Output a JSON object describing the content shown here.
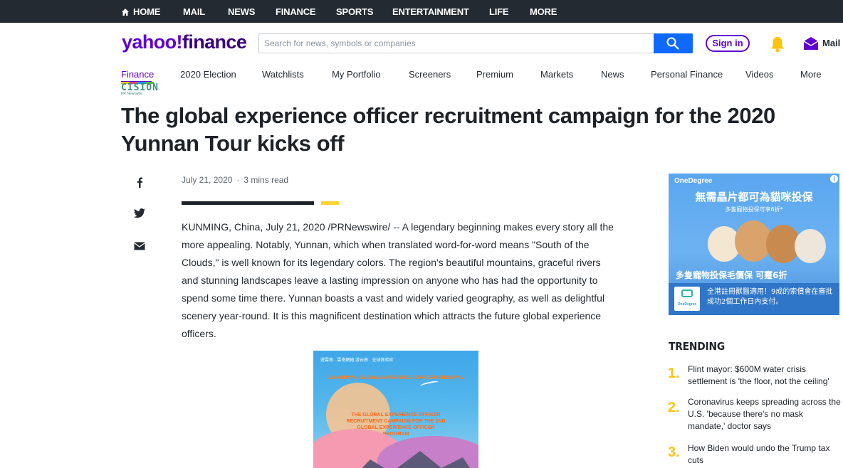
{
  "topnav": {
    "items": [
      "HOME",
      "MAIL",
      "NEWS",
      "FINANCE",
      "SPORTS",
      "ENTERTAINMENT",
      "LIFE",
      "MORE"
    ]
  },
  "header": {
    "logo_brand": "yahoo!",
    "logo_section": "finance",
    "search_placeholder": "Search for news, symbols or companies",
    "search_value": "",
    "signin_label": "Sign in",
    "mail_label": "Mail"
  },
  "subnav": {
    "items": [
      "Finance",
      "2020 Election",
      "Watchlists",
      "My Portfolio",
      "Screeners",
      "Premium",
      "Markets",
      "News",
      "Personal Finance",
      "Videos",
      "More"
    ],
    "active": "Finance"
  },
  "source": {
    "name": "CISION",
    "sub": "PR Newswire"
  },
  "article": {
    "headline": "The global experience officer recruitment campaign for the 2020 Yunnan Tour kicks off",
    "date": "July 21, 2020",
    "read_time": "3 mins read",
    "body": "KUNMING, China, July 21, 2020 /PRNewswire/ -- A legendary beginning makes every story all the more appealing. Notably, Yunnan, which when translated word-for-word means \"South of the Clouds,\" is well known for its legendary colors. The region's beautiful mountains, graceful rivers and stunning landscapes leave a lasting impression on anyone who has had the opportunity to spend some time there. Yunnan boasts a vast and widely varied geography, as well as delightful scenery year-round. It is this magnificent destination which attracts the future global experience officers.",
    "image": {
      "logos": "遊雲南 · 雲南網絡   游云南 · 全球体验官",
      "title1": "GO-YUNNAN GLOBAL EXPERIENCE OFFICER PROGRAM",
      "title2": "THE GLOBAL EXPERIENCE OFFICER RECRUITMENT CAMPAIGN FOR THE 2ND GLOBAL EXPERIENCE OFFICER PROGRAM"
    }
  },
  "share": {
    "icons": [
      "facebook-icon",
      "twitter-icon",
      "email-icon"
    ]
  },
  "ad": {
    "brand": "OneDegree",
    "headline": "無需晶片都可為貓咪投保",
    "subline": "多隻寵物投保可享6折*",
    "offer": "多隻寵物投保毛價保 可蹇6折",
    "footer_text": "全港註冊獸醫適用！9成的索償會在審批成功2個工作日內支付。",
    "footer_logo": "OneDegree"
  },
  "trending": {
    "title": "TRENDING",
    "items": [
      {
        "num": "1.",
        "text": "Flint mayor: $600M water crisis settlement is 'the floor, not the ceiling'"
      },
      {
        "num": "2.",
        "text": "Coronavirus keeps spreading across the U.S. 'because there's no mask mandate,' doctor says"
      },
      {
        "num": "3.",
        "text": "How Biden would undo the Trump tax cuts"
      }
    ]
  },
  "colors": {
    "brand_purple": "#6001d2",
    "search_blue": "#0f69ff",
    "trending_yellow": "#ffc30d",
    "topnav_bg": "#232a31"
  }
}
